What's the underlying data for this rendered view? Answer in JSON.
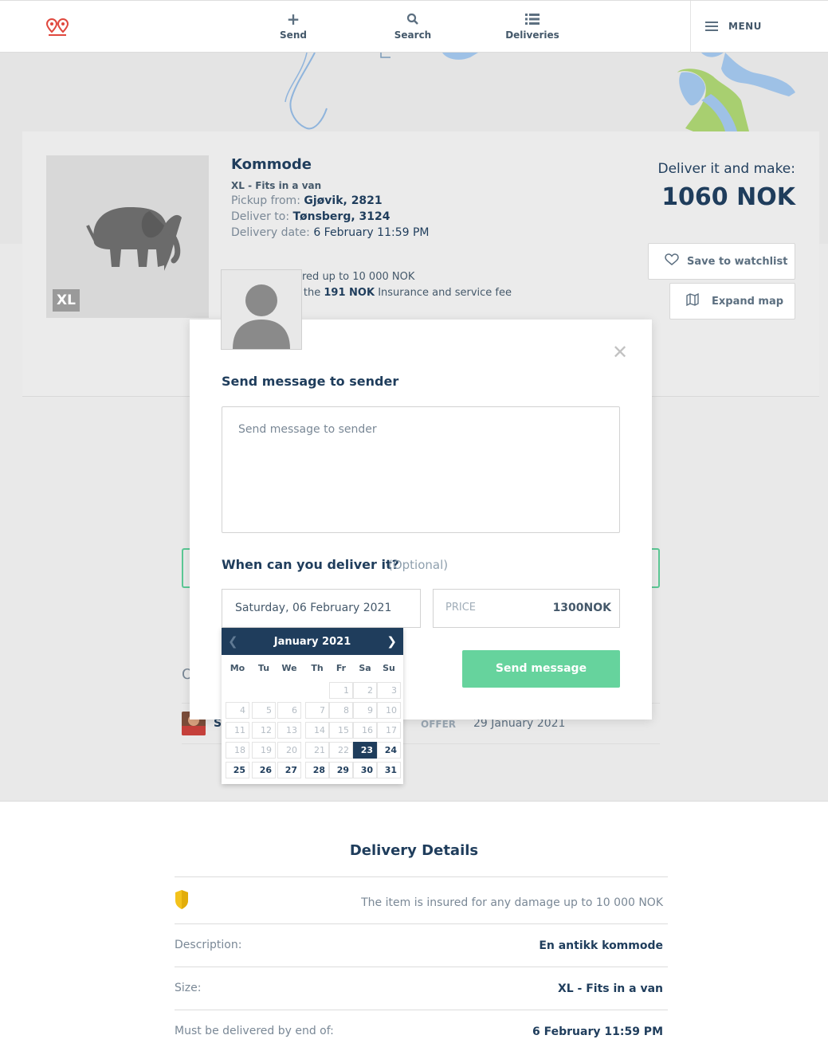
{
  "nav": {
    "send": "Send",
    "search": "Search",
    "deliveries": "Deliveries",
    "menu": "MENU"
  },
  "item": {
    "title": "Kommode",
    "size_badge": "XL",
    "size": "XL - Fits in a van",
    "pickup_label": "Pickup from:",
    "pickup_value": "Gjøvik, 2821",
    "deliver_label": "Deliver to:",
    "deliver_value": "Tønsberg, 3124",
    "date_label": "Delivery date:",
    "date_value": "6 February 11:59 PM",
    "earn_label": "Deliver it and make:",
    "earn_value": "1060 NOK",
    "insured_partial": "red up to 10 000 NOK",
    "fee_prefix": "s the",
    "fee_amount": "191 NOK",
    "fee_suffix": "Insurance and service fee"
  },
  "actions": {
    "watchlist": "Save to watchlist",
    "expand_map": "Expand map"
  },
  "modal": {
    "title": "Send message to sender",
    "message_placeholder": "Send message to sender",
    "when_label": "When can you deliver it?",
    "optional": "(Optional)",
    "date_value": "Saturday, 06 February 2021",
    "price_label": "PRICE",
    "price_value": "1300NOK",
    "send_button": "Send message"
  },
  "calendar": {
    "month": "January 2021",
    "weekdays": [
      "Mo",
      "Tu",
      "We",
      "Th",
      "Fr",
      "Sa",
      "Su"
    ],
    "today": 23,
    "first_available": 24,
    "days_in_month": 31,
    "first_weekday_index": 4
  },
  "offers": {
    "heading_partial": "O",
    "name_partial": "St",
    "status": "OFFER",
    "date": "29 January 2021"
  },
  "details": {
    "title": "Delivery Details",
    "insurance_text": "The item is insured for any damage up to 10 000 NOK",
    "rows": [
      {
        "label": "Description:",
        "value": "En antikk kommode"
      },
      {
        "label": "Size:",
        "value": "XL - Fits in a van"
      },
      {
        "label": "Must be delivered by end of:",
        "value": "6 February 11:59 PM"
      }
    ]
  },
  "colors": {
    "navy": "#1f3d5c",
    "green": "#66d39d",
    "shield": "#f3c21b",
    "logo": "#e0483e"
  }
}
